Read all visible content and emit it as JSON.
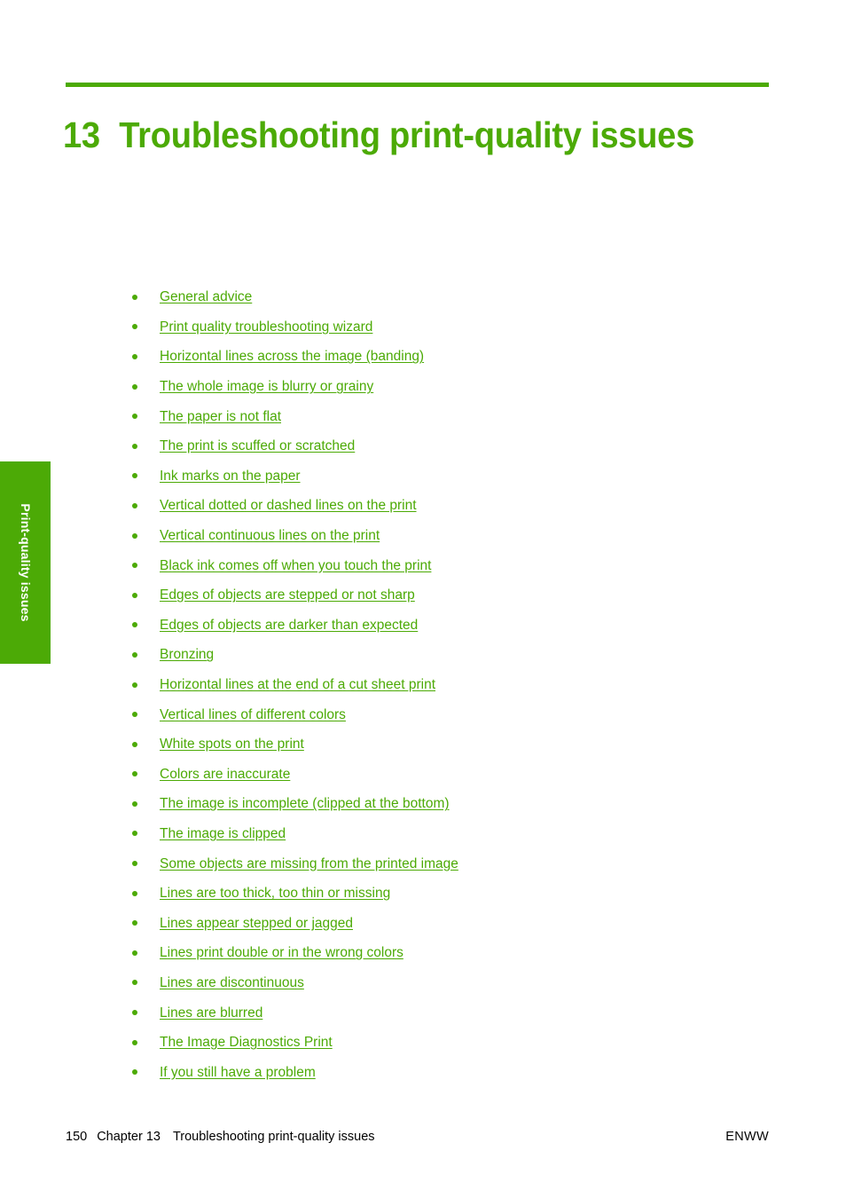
{
  "colors": {
    "brand_green": "#4CAA06",
    "text_black": "#000000",
    "page_background": "#ffffff"
  },
  "chapter": {
    "number": "13",
    "title": "Troubleshooting print-quality issues"
  },
  "side_tab": {
    "label": "Print-quality issues"
  },
  "toc": {
    "items": [
      {
        "label": "General advice"
      },
      {
        "label": "Print quality troubleshooting wizard"
      },
      {
        "label": "Horizontal lines across the image (banding)"
      },
      {
        "label": "The whole image is blurry or grainy"
      },
      {
        "label": "The paper is not flat"
      },
      {
        "label": "The print is scuffed or scratched"
      },
      {
        "label": "Ink marks on the paper"
      },
      {
        "label": "Vertical dotted or dashed lines on the print"
      },
      {
        "label": "Vertical continuous lines on the print"
      },
      {
        "label": "Black ink comes off when you touch the print"
      },
      {
        "label": "Edges of objects are stepped or not sharp"
      },
      {
        "label": "Edges of objects are darker than expected"
      },
      {
        "label": "Bronzing"
      },
      {
        "label": "Horizontal lines at the end of a cut sheet print"
      },
      {
        "label": "Vertical lines of different colors"
      },
      {
        "label": "White spots on the print"
      },
      {
        "label": "Colors are inaccurate"
      },
      {
        "label": "The image is incomplete (clipped at the bottom)"
      },
      {
        "label": "The image is clipped"
      },
      {
        "label": "Some objects are missing from the printed image"
      },
      {
        "label": "Lines are too thick, too thin or missing"
      },
      {
        "label": "Lines appear stepped or jagged"
      },
      {
        "label": "Lines print double or in the wrong colors"
      },
      {
        "label": "Lines are discontinuous"
      },
      {
        "label": "Lines are blurred"
      },
      {
        "label": "The Image Diagnostics Print"
      },
      {
        "label": "If you still have a problem"
      }
    ]
  },
  "footer": {
    "page_number": "150",
    "chapter_label": "Chapter 13",
    "chapter_title": "Troubleshooting print-quality issues",
    "locale_code": "ENWW"
  }
}
